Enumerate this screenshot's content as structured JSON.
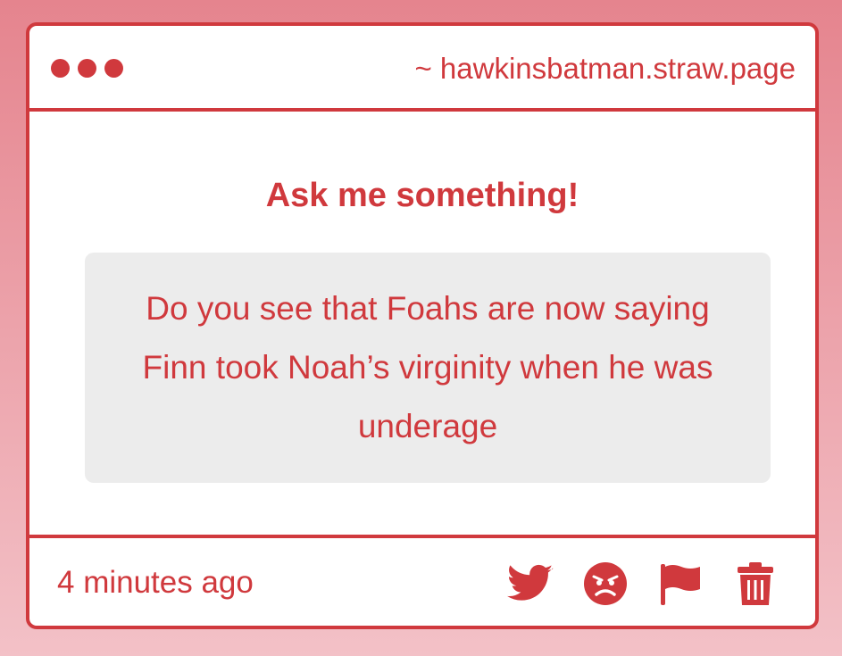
{
  "window": {
    "url": "~ hawkinsbatman.straw.page",
    "dot_count": 3
  },
  "main": {
    "heading": "Ask me something!",
    "question": "Do you see that Foahs are now saying Finn took Noah’s virginity when he was underage"
  },
  "footer": {
    "timestamp": "4 minutes ago",
    "icons": [
      "twitter-icon",
      "angry-face-icon",
      "flag-icon",
      "trash-icon"
    ]
  },
  "colors": {
    "accent": "#d0393d",
    "question_bg": "#ececec",
    "page_bg_top": "#e5848e",
    "page_bg_bottom": "#f3c1c7"
  }
}
